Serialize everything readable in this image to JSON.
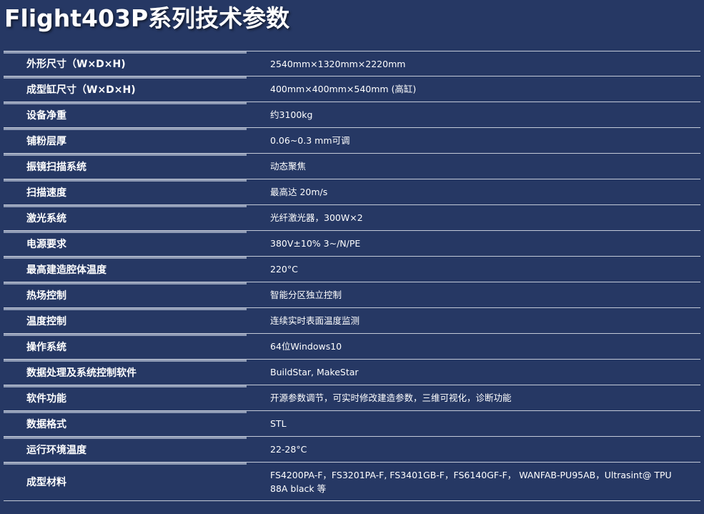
{
  "title": "Flight403P系列技术参数",
  "specs": [
    {
      "label": "外形尺寸（W×D×H)",
      "value": "2540mm×1320mm×2220mm"
    },
    {
      "label": "成型缸尺寸（W×D×H)",
      "value": "400mm×400mm×540mm (高缸)"
    },
    {
      "label": "设备净重",
      "value": "约3100kg"
    },
    {
      "label": "铺粉层厚",
      "value": "0.06~0.3 mm可调"
    },
    {
      "label": "振镜扫描系统",
      "value": "动态聚焦"
    },
    {
      "label": "扫描速度",
      "value": "最高达 20m/s"
    },
    {
      "label": "激光系统",
      "value": "光纤激光器，300W×2"
    },
    {
      "label": "电源要求",
      "value": "380V±10% 3~/N/PE"
    },
    {
      "label": "最高建造腔体温度",
      "value": "220°C"
    },
    {
      "label": "热场控制",
      "value": "智能分区独立控制"
    },
    {
      "label": "温度控制",
      "value": "连续实时表面温度监测"
    },
    {
      "label": "操作系统",
      "value": "64位Windows10"
    },
    {
      "label": "数据处理及系统控制软件",
      "value": "BuildStar, MakeStar"
    },
    {
      "label": "软件功能",
      "value": "开源参数调节，可实时修改建造参数，三维可视化，诊断功能"
    },
    {
      "label": "数据格式",
      "value": "STL"
    },
    {
      "label": "运行环境温度",
      "value": "22-28°C"
    },
    {
      "label": "成型材料",
      "value": "FS4200PA-F，FS3201PA-F, FS3401GB-F，FS6140GF-F， WANFAB-PU95AB，Ultrasint@ TPU 88A black 等"
    }
  ]
}
